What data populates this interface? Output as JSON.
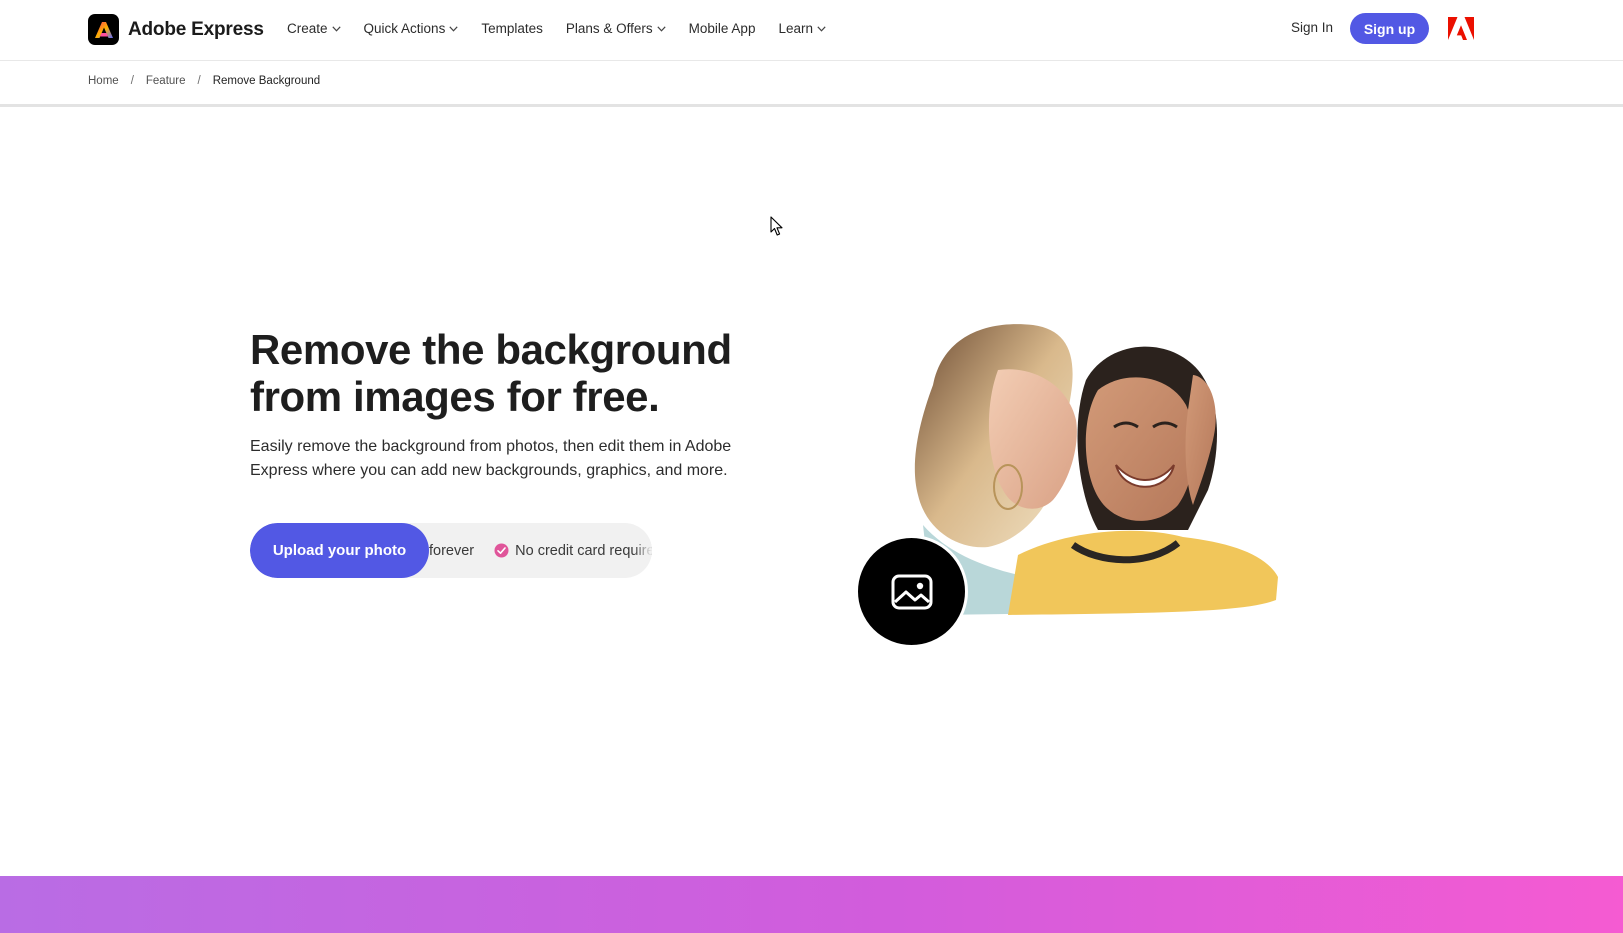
{
  "header": {
    "brand": "Adobe Express",
    "nav": [
      {
        "label": "Create",
        "has_dropdown": true
      },
      {
        "label": "Quick Actions",
        "has_dropdown": true
      },
      {
        "label": "Templates",
        "has_dropdown": false
      },
      {
        "label": "Plans & Offers",
        "has_dropdown": true
      },
      {
        "label": "Mobile App",
        "has_dropdown": false
      },
      {
        "label": "Learn",
        "has_dropdown": true
      }
    ],
    "sign_in": "Sign In",
    "sign_up": "Sign up",
    "icons": {
      "brand": "adobe-express-logo-icon",
      "corporate": "adobe-logo-icon",
      "dropdown": "chevron-down-icon"
    }
  },
  "breadcrumb": {
    "items": [
      "Home",
      "Feature",
      "Remove Background"
    ],
    "separator": "/"
  },
  "hero": {
    "title_line1": "Remove the background",
    "title_line2": "from images for free.",
    "subtitle": "Easily remove the background from photos, then edit them in Adobe Express where you can add new backgrounds, graphics, and more.",
    "cta": "Upload your photo",
    "ticker": [
      "forever",
      "No credit card require"
    ],
    "icons": {
      "ticker": "check-circle-icon",
      "badge": "image-icon"
    }
  },
  "colors": {
    "accent": "#5258e4",
    "check": "#e0559a",
    "adobe_red": "#eb1000",
    "band_start": "#b96ce4",
    "band_end": "#f55bd2"
  }
}
